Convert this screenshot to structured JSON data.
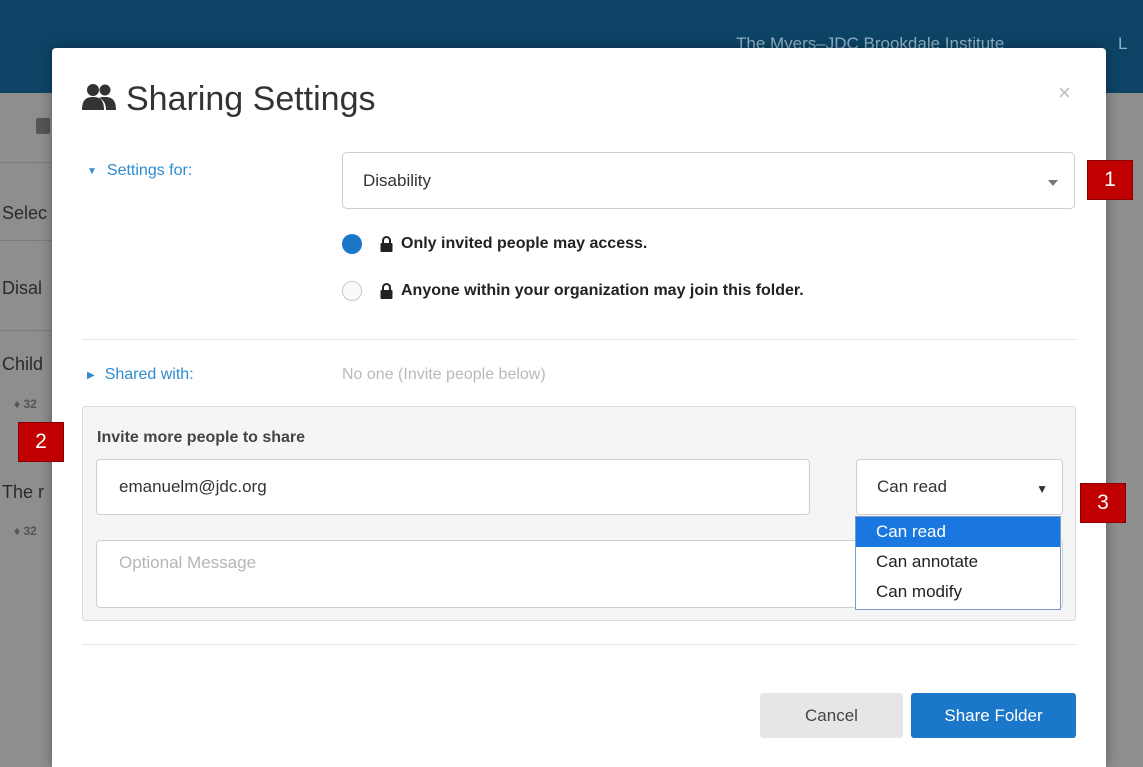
{
  "background": {
    "org_name": "The Myers–JDC Brookdale Institute",
    "header_extra": "L",
    "sidebar_texts": [
      "Selec",
      "Disal",
      "Child",
      "The r"
    ],
    "sidebar_tags": [
      "32",
      "32"
    ]
  },
  "modal": {
    "title": "Sharing Settings",
    "close_label": "×",
    "settings_for_label": "Settings for:",
    "folder_selected": "Disability",
    "access_options": [
      {
        "label": "Only invited people may access.",
        "selected": true
      },
      {
        "label": "Anyone within your organization may join this folder.",
        "selected": false
      }
    ],
    "shared_with_label": "Shared with:",
    "shared_with_value": "No one (Invite people below)",
    "invite": {
      "title": "Invite more people to share",
      "email_value": "emanuelm@jdc.org",
      "permission_selected": "Can read",
      "permission_options": [
        "Can read",
        "Can annotate",
        "Can modify"
      ],
      "message_placeholder": "Optional Message"
    },
    "cancel_label": "Cancel",
    "share_label": "Share Folder"
  },
  "callouts": [
    "1",
    "2",
    "3"
  ],
  "colors": {
    "header_bg": "#0d4466",
    "accent_blue": "#1a77c9",
    "link_blue": "#2e8ccf",
    "callout_red": "#c00000"
  }
}
